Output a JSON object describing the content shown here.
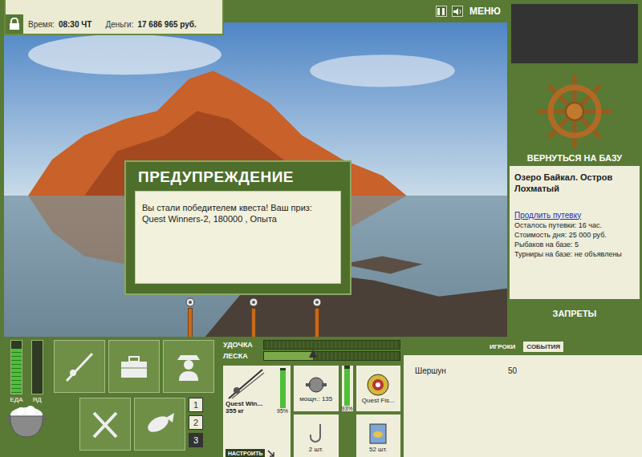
{
  "status": {
    "time_label": "Время:",
    "time": "08:30 ЧТ",
    "money_label": "Деньги:",
    "money": "17 686 965 руб."
  },
  "header": {
    "menu": "МЕНЮ"
  },
  "dialog": {
    "title": "ПРЕДУПРЕЖДЕНИЕ",
    "message": "Вы стали победителем квеста! Ваш приз: Quest Winners-2, 180000 , Опыта"
  },
  "rod_holders": [
    {
      "occupied": true
    },
    {
      "occupied": true
    },
    {
      "occupied": true
    }
  ],
  "sidebar": {
    "return_label": "ВЕРНУТЬСЯ НА БАЗУ",
    "location": "Озеро Байкал. Остров Лохматый",
    "link": "Продлить путевку",
    "info": [
      "Осталось путевки: 16 час.",
      "Стоимость дня: 25 000 руб.",
      "Рыбаков на базе: 5",
      "Турниры на базе: не объявлены"
    ],
    "bans": "ЗАПРЕТЫ"
  },
  "meters": [
    {
      "label": "ЕДА",
      "level": 0.85
    },
    {
      "label": "ЯД",
      "level": 0
    }
  ],
  "pages": [
    {
      "label": "1",
      "selected": false
    },
    {
      "label": "2",
      "selected": false
    },
    {
      "label": "3",
      "selected": true
    }
  ],
  "tension": [
    {
      "label": "УДОЧКА",
      "level": 0
    },
    {
      "label": "ЛЕСКА",
      "level": 0.36
    }
  ],
  "tackle": {
    "rod": {
      "name": "Quest Win...",
      "weight": "355 кг",
      "condition": "95%",
      "level": 0.95,
      "button": "НАСТРОИТЬ"
    },
    "reel": {
      "power": "мощн.: 135",
      "condition": "93%",
      "level": 0.93
    },
    "line": {
      "name": "Quest Fis..."
    },
    "hook": {
      "count": "2 шт."
    },
    "bait": {
      "count": "52 шт."
    }
  },
  "events": {
    "tabs": [
      {
        "label": "ИГРОКИ",
        "selected": false
      },
      {
        "label": "СОБЫТИЯ",
        "selected": true
      }
    ],
    "rows": [
      {
        "name": "Шершун",
        "value": "50"
      }
    ]
  }
}
